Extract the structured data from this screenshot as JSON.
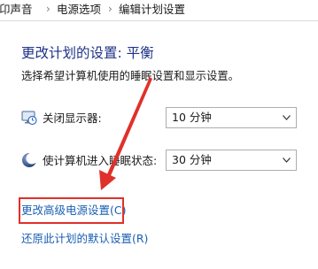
{
  "breadcrumb": {
    "items": [
      "卬声音",
      "电源选项",
      "编辑计划设置"
    ]
  },
  "plan": {
    "title": "更改计划的设置: 平衡",
    "description": "选择希望计算机使用的睡眠设置和显示设置。"
  },
  "settings": {
    "display_off": {
      "label": "关闭显示器:",
      "value": "10 分钟",
      "icon": "monitor-clock-icon"
    },
    "sleep": {
      "label": "使计算机进入睡眠状态:",
      "value": "30 分钟",
      "icon": "moon-icon"
    }
  },
  "links": {
    "advanced": "更改高级电源设置(C)",
    "restore": "还原此计划的默认设置(R)"
  },
  "annotation": {
    "color": "#e0302b"
  }
}
